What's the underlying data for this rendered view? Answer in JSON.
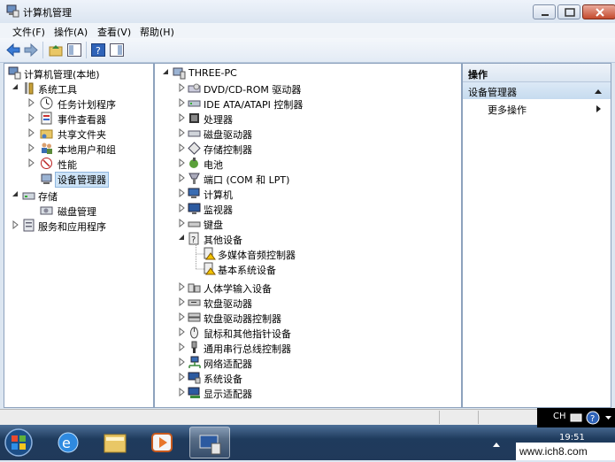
{
  "window": {
    "title": "计算机管理"
  },
  "menu": [
    "文件(F)",
    "操作(A)",
    "查看(V)",
    "帮助(H)"
  ],
  "left_tree": {
    "root": "计算机管理(本地)",
    "system_tools": "系统工具",
    "items": [
      "任务计划程序",
      "事件查看器",
      "共享文件夹",
      "本地用户和组",
      "性能",
      "设备管理器"
    ],
    "storage": "存储",
    "disk_mgmt": "磁盘管理",
    "services": "服务和应用程序"
  },
  "device_tree": {
    "root": "THREE-PC",
    "items": [
      "DVD/CD-ROM 驱动器",
      "IDE ATA/ATAPI 控制器",
      "处理器",
      "磁盘驱动器",
      "存储控制器",
      "电池",
      "端口 (COM 和 LPT)",
      "计算机",
      "监视器",
      "键盘",
      "其他设备",
      "多媒体音频控制器",
      "基本系统设备",
      "人体学输入设备",
      "软盘驱动器",
      "软盘驱动器控制器",
      "鼠标和其他指针设备",
      "通用串行总线控制器",
      "网络适配器",
      "系统设备",
      "显示适配器"
    ]
  },
  "actions": {
    "header": "操作",
    "section": "设备管理器",
    "more": "更多操作"
  },
  "taskbar": {
    "lang": "CH",
    "time": "19:51"
  },
  "watermark": "www.ich8.com"
}
